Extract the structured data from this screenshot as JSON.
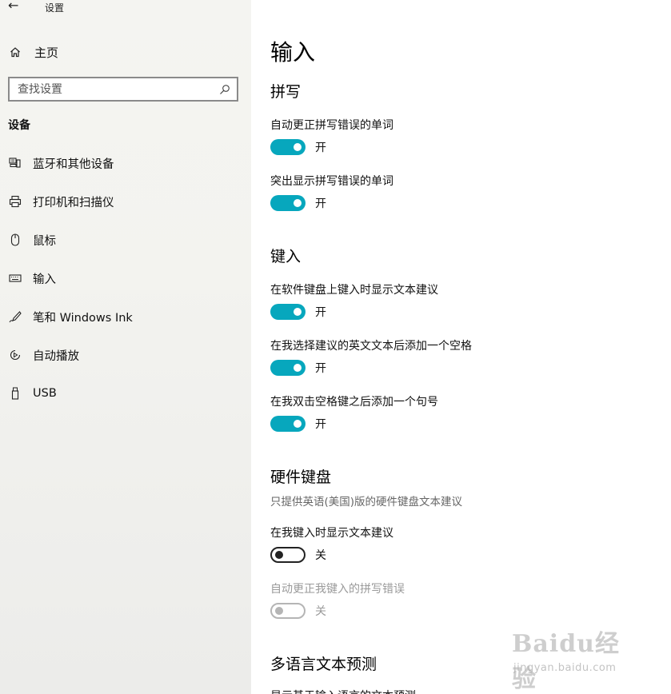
{
  "window": {
    "title": "设置",
    "back_glyph": "←"
  },
  "sidebar": {
    "home_label": "主页",
    "search_placeholder": "查找设置",
    "section_label": "设备",
    "items": [
      {
        "label": "蓝牙和其他设备",
        "icon": "bluetooth-devices-icon"
      },
      {
        "label": "打印机和扫描仪",
        "icon": "printer-icon"
      },
      {
        "label": "鼠标",
        "icon": "mouse-icon"
      },
      {
        "label": "输入",
        "icon": "keyboard-icon"
      },
      {
        "label": "笔和 Windows Ink",
        "icon": "pen-icon"
      },
      {
        "label": "自动播放",
        "icon": "autoplay-icon"
      },
      {
        "label": "USB",
        "icon": "usb-icon"
      }
    ]
  },
  "main": {
    "title": "输入",
    "spelling": {
      "heading": "拼写",
      "autocorrect": {
        "label": "自动更正拼写错误的单词",
        "state": "开"
      },
      "highlight": {
        "label": "突出显示拼写错误的单词",
        "state": "开"
      }
    },
    "typing": {
      "heading": "键入",
      "suggestions": {
        "label": "在软件键盘上键入时显示文本建议",
        "state": "开"
      },
      "add_space": {
        "label": "在我选择建议的英文文本后添加一个空格",
        "state": "开"
      },
      "add_period": {
        "label": "在我双击空格键之后添加一个句号",
        "state": "开"
      }
    },
    "hardware_keyboard": {
      "heading": "硬件键盘",
      "description": "只提供英语(美国)版的硬件键盘文本建议",
      "show_suggestions": {
        "label": "在我键入时显示文本建议",
        "state": "关"
      },
      "autocorrect": {
        "label": "自动更正我键入的拼写错误",
        "state": "关"
      }
    },
    "multilingual": {
      "heading": "多语言文本预测",
      "cutoff_label": "显示基于输入语言的文本预测"
    }
  },
  "watermark": {
    "brand": "Baidu经验",
    "url": "jingyan.baidu.com"
  },
  "colors": {
    "accent": "#07a7bd",
    "sidebar_bg": "#f3f3ef"
  }
}
